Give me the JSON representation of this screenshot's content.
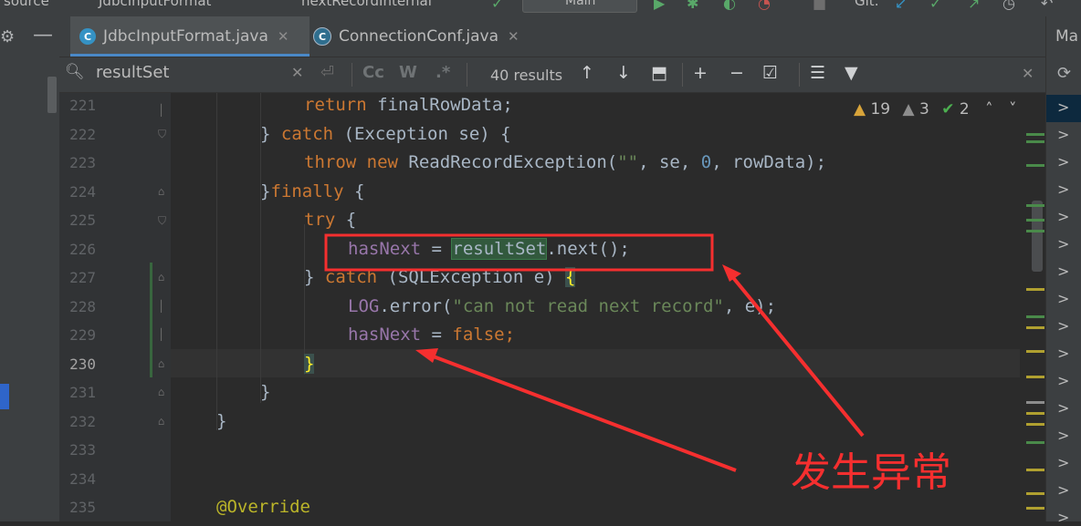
{
  "topbar": {
    "breadcrumb": [
      "source",
      "JdbcInputFormat",
      "nextRecordInternal"
    ],
    "branch": "Main",
    "git_label": "Git:"
  },
  "tabs": [
    {
      "label": "JdbcInputFormat.java",
      "active": true
    },
    {
      "label": "ConnectionConf.java",
      "active": false
    }
  ],
  "right_panel": {
    "title": "Ma"
  },
  "search": {
    "value": "resultSet",
    "match_case": "Cc",
    "words": "W",
    "regex": ".*",
    "results": "40 results"
  },
  "inspections": {
    "warnings": "19",
    "weak_warnings": "3",
    "ok": "2"
  },
  "editor": {
    "lines": [
      {
        "n": "221"
      },
      {
        "n": "222"
      },
      {
        "n": "223"
      },
      {
        "n": "224"
      },
      {
        "n": "225"
      },
      {
        "n": "226"
      },
      {
        "n": "227"
      },
      {
        "n": "228"
      },
      {
        "n": "229"
      },
      {
        "n": "230"
      },
      {
        "n": "231"
      },
      {
        "n": "232"
      },
      {
        "n": "233"
      },
      {
        "n": "234"
      },
      {
        "n": "235"
      }
    ],
    "tokens": {
      "return": "return",
      "finalRowData": " finalRowData;",
      "catch": "catch",
      "exception": " (Exception se) {",
      "throw": "throw",
      "new": "new",
      "rre": " ReadRecordException(",
      "emptystr": "\"\"",
      "se_zero": ", se, ",
      "zero": "0",
      "rowdata": ", rowData);",
      "finally": "finally",
      "brace_open": " {",
      "try": "try",
      "hasNext": "hasNext",
      "eq": " = ",
      "resultSet": "resultSet",
      "next": ".next();",
      "catch2": "catch",
      "sqlex": " (SQLException e) ",
      "lbrace": "{",
      "log": "LOG",
      "error": ".error(",
      "msg": "\"can not read next record\"",
      "e_end": ", e);",
      "false": "false",
      "semi": ";",
      "rbrace": "}",
      "override": "@Override"
    }
  },
  "annotation": {
    "note": "发生异常",
    "color": "#f52f2f"
  }
}
